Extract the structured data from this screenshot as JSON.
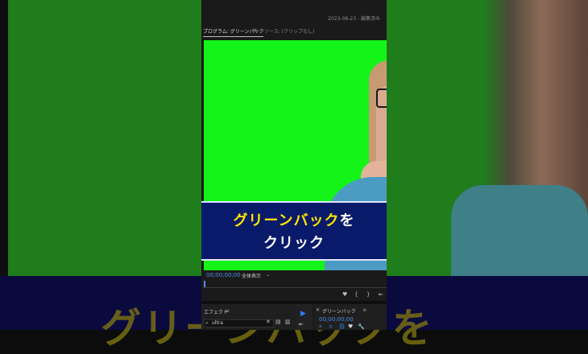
{
  "header": {
    "status": "2023-08-23 - 編集済み"
  },
  "tabs": {
    "program_label": "プログラム: グリーンバック",
    "menu_glyph": "≡",
    "source_label": "ソース: (クリップなし)"
  },
  "caption": {
    "line1_highlight": "グリーンバック",
    "line1_rest": "を",
    "line2": "クリック"
  },
  "background_text": "グリーンバックを",
  "monitor_controls": {
    "timecode": "00;00;00;00",
    "zoom": "全体表示",
    "zoom_arrow": "⌄"
  },
  "transport": {
    "marker": "♥",
    "in_point": "{",
    "out_point": "}",
    "goto_in": "⇤"
  },
  "effects_panel": {
    "title": "エフェクト",
    "menu_glyph": "≡",
    "search_value": "ultra",
    "clear_glyph": "✕",
    "new_bin": "▤",
    "new_item": "▥"
  },
  "tools": {
    "selection": "▶",
    "track_select": "⇤"
  },
  "timeline_panel": {
    "close_glyph": "✕",
    "title": "グリーンバック",
    "menu_glyph": "≡",
    "timecode": "00;00;00;00"
  },
  "colors": {
    "chroma_green": "#14f419",
    "caption_bg": "#0a1a6a",
    "caption_highlight": "#ffe400",
    "timecode_blue": "#4d8fe6"
  }
}
